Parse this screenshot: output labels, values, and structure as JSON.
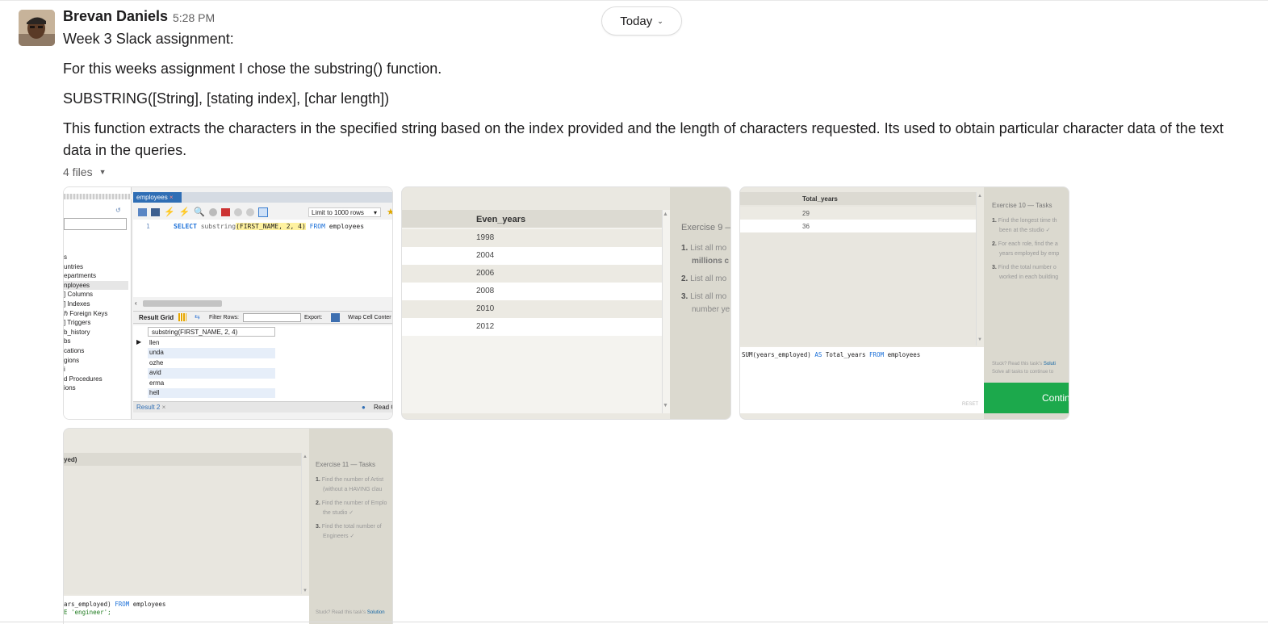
{
  "header": {
    "today_label": "Today"
  },
  "message": {
    "author": "Brevan Daniels",
    "time": "5:28 PM",
    "lines": [
      "Week 3 Slack assignment:",
      "For this weeks assignment I chose the substring() function.",
      "SUBSTRING([String], [stating index], [char length])",
      "This function extracts the characters in the specified string based on the index provided and the length of characters requested. Its used to obtain particular character data of the text",
      "data in the queries."
    ],
    "files_label": "4 files"
  },
  "thumb1": {
    "tab": "employees",
    "limit": "Limit to 1000 rows",
    "line_no": "1",
    "sql_kw1": "SELECT",
    "sql_fn": "substring",
    "sql_args": "(FIRST_NAME, 2, 4)",
    "sql_kw2": "FROM",
    "sql_tbl": "employees",
    "tree": [
      "s",
      "untries",
      "epartments",
      "nployees",
      "] Columns",
      "] Indexes",
      "ℏ Foreign Keys",
      "] Triggers",
      "b_history",
      "bs",
      "cations",
      "gions",
      "i",
      "d Procedures",
      "ions"
    ],
    "result_grid": "Result Grid",
    "filter_rows": "Filter Rows:",
    "export": "Export:",
    "wrap": "Wrap Cell Conter",
    "col_header": "substring(FIRST_NAME, 2, 4)",
    "rows": [
      "llen",
      "unda",
      "ozhe",
      "avid",
      "erma",
      "hell"
    ],
    "result_tab": "Result 2",
    "read": "Read C"
  },
  "thumb2": {
    "col_header": "Even_years",
    "rows": [
      "1998",
      "2004",
      "2006",
      "2008",
      "2010",
      "2012"
    ],
    "exercise_title": "Exercise 9 —",
    "tasks": [
      "List all mo",
      "millions c",
      "List all mo",
      "List all mo",
      "number ye"
    ]
  },
  "thumb3": {
    "col_header": "Total_years",
    "rows": [
      "29",
      "36"
    ],
    "sql_a": "SUM(years_employed)",
    "sql_as": "AS",
    "sql_b": "Total_years",
    "sql_from": "FROM",
    "sql_tbl": "employees",
    "reset": "RESET",
    "exercise_title": "Exercise 10 — Tasks",
    "tasks": [
      "Find the longest time th",
      "been at the studio ✓",
      "For each role, find the a",
      "years employed by emp",
      "Find the total number o",
      "worked in each building"
    ],
    "stuck_a": "Stuck? Read this task's",
    "stuck_link": "Soluti",
    "stuck_b": "Solve all tasks to continue to",
    "continue": "Contin"
  },
  "thumb4": {
    "col_header": "yed)",
    "exercise_title": "Exercise 11 — Tasks",
    "tasks": [
      "Find the number of Artist",
      "(without a HAVING clau",
      "Find the number of Emplo",
      "the studio ✓",
      "Find the total number of",
      "Engineers ✓"
    ],
    "sql_a": "ars_employed)",
    "sql_from": "FROM",
    "sql_tbl": "employees",
    "sql_c": "E 'engineer';",
    "stuck_a": "Stuck? Read this task's",
    "stuck_link": "Solution"
  },
  "colors": {
    "accent_green": "#1ca94c",
    "link_blue": "#1264a3",
    "sql_blue": "#1a6fd8"
  }
}
